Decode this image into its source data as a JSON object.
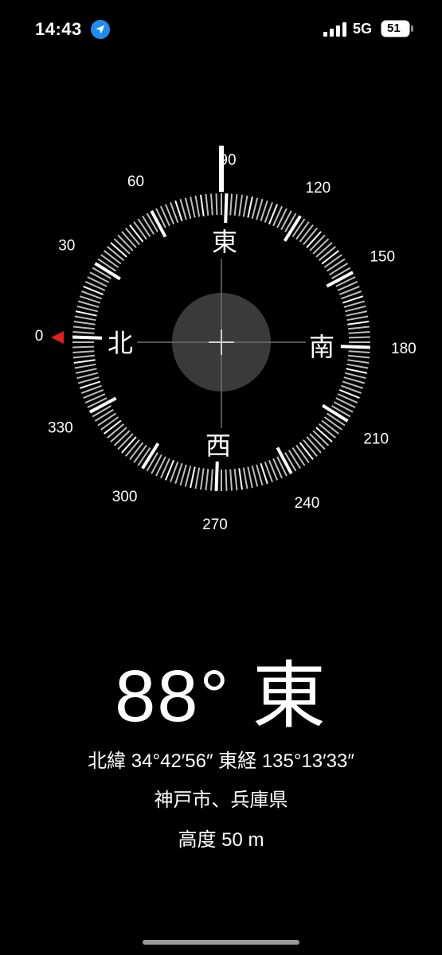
{
  "status_bar": {
    "time": "14:43",
    "network": "5G",
    "battery": "51",
    "location_icon": "location-arrow-icon",
    "signal_icon": "signal-bars-icon"
  },
  "compass": {
    "heading_degrees": 88,
    "degree_labels": [
      "0",
      "30",
      "60",
      "90",
      "120",
      "150",
      "180",
      "210",
      "240",
      "270",
      "300",
      "330"
    ],
    "cardinals": {
      "north": "北",
      "east": "東",
      "south": "南",
      "west": "西"
    },
    "north_marker_color": "#e0221b"
  },
  "readout": {
    "heading": "88° 東",
    "coordinates": "北緯 34°42′56″ 東経 135°13′33″",
    "place": "神戸市、兵庫県",
    "altitude": "高度 50 m"
  }
}
